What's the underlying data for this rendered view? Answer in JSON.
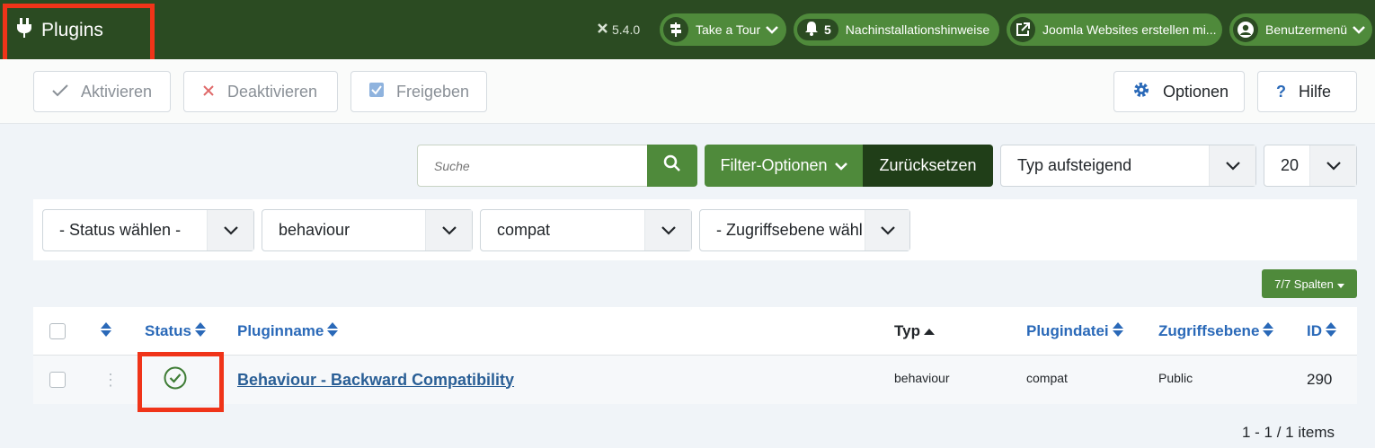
{
  "header": {
    "title": "Plugins",
    "version": "5.4.0",
    "tour_label": "Take a Tour",
    "notifications_count": "5",
    "notifications_label": "Nachinstallationshinweise",
    "external_label": "Joomla Websites erstellen mi...",
    "user_menu_label": "Benutzermenü"
  },
  "toolbar": {
    "activate_label": "Aktivieren",
    "deactivate_label": "Deaktivieren",
    "approve_label": "Freigeben",
    "options_label": "Optionen",
    "help_label": "Hilfe"
  },
  "filters": {
    "search_placeholder": "Suche",
    "filter_options_label": "Filter-Optionen",
    "reset_label": "Zurücksetzen",
    "sort_value": "Typ aufsteigend",
    "limit_value": "20",
    "status_value": "- Status wählen -",
    "type_value": "behaviour",
    "element_value": "compat",
    "access_value": "- Zugriffsebene wähl"
  },
  "columns_button_label": "7/7 Spalten",
  "table": {
    "headers": {
      "status": "Status",
      "name": "Pluginname",
      "type": "Typ",
      "file": "Plugindatei",
      "access": "Zugriffsebene",
      "id": "ID"
    },
    "rows": [
      {
        "name": "Behaviour - Backward Compatibility",
        "type": "behaviour",
        "file": "compat",
        "access": "Public",
        "id": "290",
        "enabled": true
      }
    ]
  },
  "pagination": "1 - 1 / 1 items",
  "colors": {
    "header_bg": "#2b4b22",
    "accent_green": "#4f8a3b",
    "highlight_red": "#f03419",
    "link_blue": "#2a69b8"
  }
}
